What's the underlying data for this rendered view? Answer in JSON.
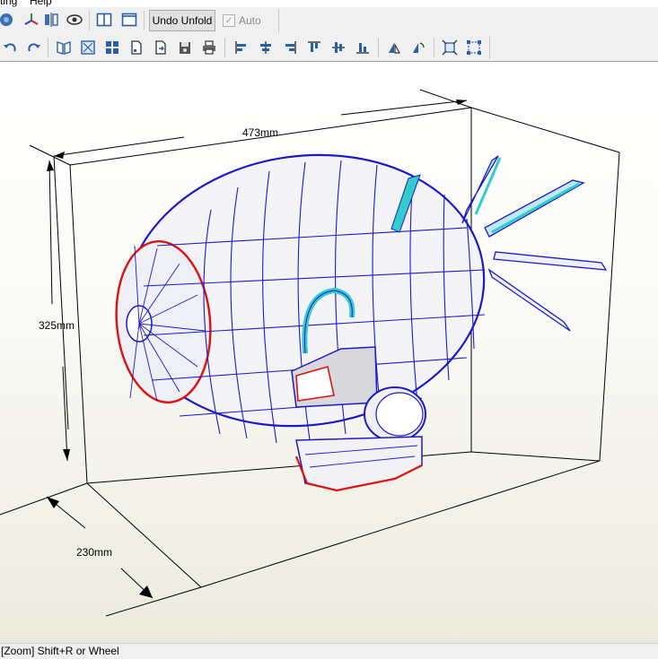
{
  "menubar": {
    "items": [
      "ting",
      "Help"
    ]
  },
  "toolbar": {
    "undo_unfold_label": "Undo Unfold",
    "auto_label": "Auto",
    "auto_checked": true,
    "icons_row1": [
      "open-icon",
      "axes-icon",
      "mirror-icon",
      "view-eye-icon",
      "split-view-icon",
      "single-view-icon"
    ],
    "icons_row2": [
      "undo-icon",
      "redo-icon",
      "book-icon",
      "arrange-icon",
      "grid-icon",
      "page-icon",
      "export-icon",
      "save-icon",
      "print-icon",
      "align-left-icon",
      "align-center-icon",
      "align-right-icon",
      "align-top-icon",
      "align-middle-icon",
      "align-bottom-icon",
      "flip-icon",
      "rotate-icon",
      "fit-icon",
      "select-all-icon"
    ]
  },
  "viewport": {
    "dim_width": "473mm",
    "dim_height": "325mm",
    "dim_depth": "230mm"
  },
  "status": {
    "text": "[Zoom] Shift+R or Wheel"
  },
  "colors": {
    "toolbar_bg": "#f0f0f0",
    "model_edges": "#1a1acc",
    "cut_edges": "#dd1111",
    "accent_cyan": "#33cccc"
  }
}
